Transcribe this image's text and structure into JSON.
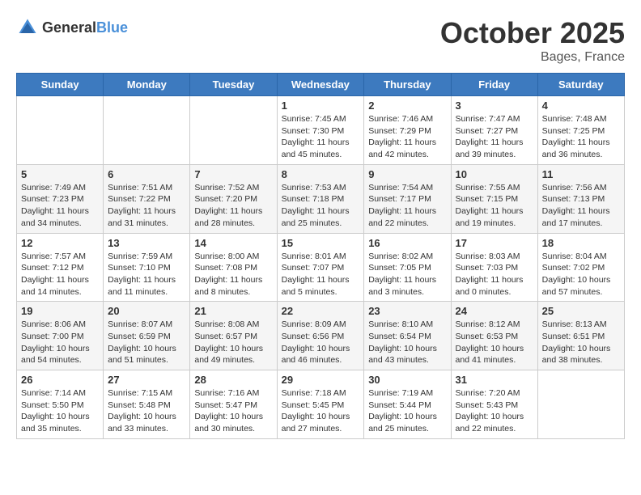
{
  "header": {
    "logo_general": "General",
    "logo_blue": "Blue",
    "month": "October 2025",
    "location": "Bages, France"
  },
  "days_of_week": [
    "Sunday",
    "Monday",
    "Tuesday",
    "Wednesday",
    "Thursday",
    "Friday",
    "Saturday"
  ],
  "weeks": [
    [
      {
        "day": "",
        "info": ""
      },
      {
        "day": "",
        "info": ""
      },
      {
        "day": "",
        "info": ""
      },
      {
        "day": "1",
        "info": "Sunrise: 7:45 AM\nSunset: 7:30 PM\nDaylight: 11 hours and 45 minutes."
      },
      {
        "day": "2",
        "info": "Sunrise: 7:46 AM\nSunset: 7:29 PM\nDaylight: 11 hours and 42 minutes."
      },
      {
        "day": "3",
        "info": "Sunrise: 7:47 AM\nSunset: 7:27 PM\nDaylight: 11 hours and 39 minutes."
      },
      {
        "day": "4",
        "info": "Sunrise: 7:48 AM\nSunset: 7:25 PM\nDaylight: 11 hours and 36 minutes."
      }
    ],
    [
      {
        "day": "5",
        "info": "Sunrise: 7:49 AM\nSunset: 7:23 PM\nDaylight: 11 hours and 34 minutes."
      },
      {
        "day": "6",
        "info": "Sunrise: 7:51 AM\nSunset: 7:22 PM\nDaylight: 11 hours and 31 minutes."
      },
      {
        "day": "7",
        "info": "Sunrise: 7:52 AM\nSunset: 7:20 PM\nDaylight: 11 hours and 28 minutes."
      },
      {
        "day": "8",
        "info": "Sunrise: 7:53 AM\nSunset: 7:18 PM\nDaylight: 11 hours and 25 minutes."
      },
      {
        "day": "9",
        "info": "Sunrise: 7:54 AM\nSunset: 7:17 PM\nDaylight: 11 hours and 22 minutes."
      },
      {
        "day": "10",
        "info": "Sunrise: 7:55 AM\nSunset: 7:15 PM\nDaylight: 11 hours and 19 minutes."
      },
      {
        "day": "11",
        "info": "Sunrise: 7:56 AM\nSunset: 7:13 PM\nDaylight: 11 hours and 17 minutes."
      }
    ],
    [
      {
        "day": "12",
        "info": "Sunrise: 7:57 AM\nSunset: 7:12 PM\nDaylight: 11 hours and 14 minutes."
      },
      {
        "day": "13",
        "info": "Sunrise: 7:59 AM\nSunset: 7:10 PM\nDaylight: 11 hours and 11 minutes."
      },
      {
        "day": "14",
        "info": "Sunrise: 8:00 AM\nSunset: 7:08 PM\nDaylight: 11 hours and 8 minutes."
      },
      {
        "day": "15",
        "info": "Sunrise: 8:01 AM\nSunset: 7:07 PM\nDaylight: 11 hours and 5 minutes."
      },
      {
        "day": "16",
        "info": "Sunrise: 8:02 AM\nSunset: 7:05 PM\nDaylight: 11 hours and 3 minutes."
      },
      {
        "day": "17",
        "info": "Sunrise: 8:03 AM\nSunset: 7:03 PM\nDaylight: 11 hours and 0 minutes."
      },
      {
        "day": "18",
        "info": "Sunrise: 8:04 AM\nSunset: 7:02 PM\nDaylight: 10 hours and 57 minutes."
      }
    ],
    [
      {
        "day": "19",
        "info": "Sunrise: 8:06 AM\nSunset: 7:00 PM\nDaylight: 10 hours and 54 minutes."
      },
      {
        "day": "20",
        "info": "Sunrise: 8:07 AM\nSunset: 6:59 PM\nDaylight: 10 hours and 51 minutes."
      },
      {
        "day": "21",
        "info": "Sunrise: 8:08 AM\nSunset: 6:57 PM\nDaylight: 10 hours and 49 minutes."
      },
      {
        "day": "22",
        "info": "Sunrise: 8:09 AM\nSunset: 6:56 PM\nDaylight: 10 hours and 46 minutes."
      },
      {
        "day": "23",
        "info": "Sunrise: 8:10 AM\nSunset: 6:54 PM\nDaylight: 10 hours and 43 minutes."
      },
      {
        "day": "24",
        "info": "Sunrise: 8:12 AM\nSunset: 6:53 PM\nDaylight: 10 hours and 41 minutes."
      },
      {
        "day": "25",
        "info": "Sunrise: 8:13 AM\nSunset: 6:51 PM\nDaylight: 10 hours and 38 minutes."
      }
    ],
    [
      {
        "day": "26",
        "info": "Sunrise: 7:14 AM\nSunset: 5:50 PM\nDaylight: 10 hours and 35 minutes."
      },
      {
        "day": "27",
        "info": "Sunrise: 7:15 AM\nSunset: 5:48 PM\nDaylight: 10 hours and 33 minutes."
      },
      {
        "day": "28",
        "info": "Sunrise: 7:16 AM\nSunset: 5:47 PM\nDaylight: 10 hours and 30 minutes."
      },
      {
        "day": "29",
        "info": "Sunrise: 7:18 AM\nSunset: 5:45 PM\nDaylight: 10 hours and 27 minutes."
      },
      {
        "day": "30",
        "info": "Sunrise: 7:19 AM\nSunset: 5:44 PM\nDaylight: 10 hours and 25 minutes."
      },
      {
        "day": "31",
        "info": "Sunrise: 7:20 AM\nSunset: 5:43 PM\nDaylight: 10 hours and 22 minutes."
      },
      {
        "day": "",
        "info": ""
      }
    ]
  ]
}
